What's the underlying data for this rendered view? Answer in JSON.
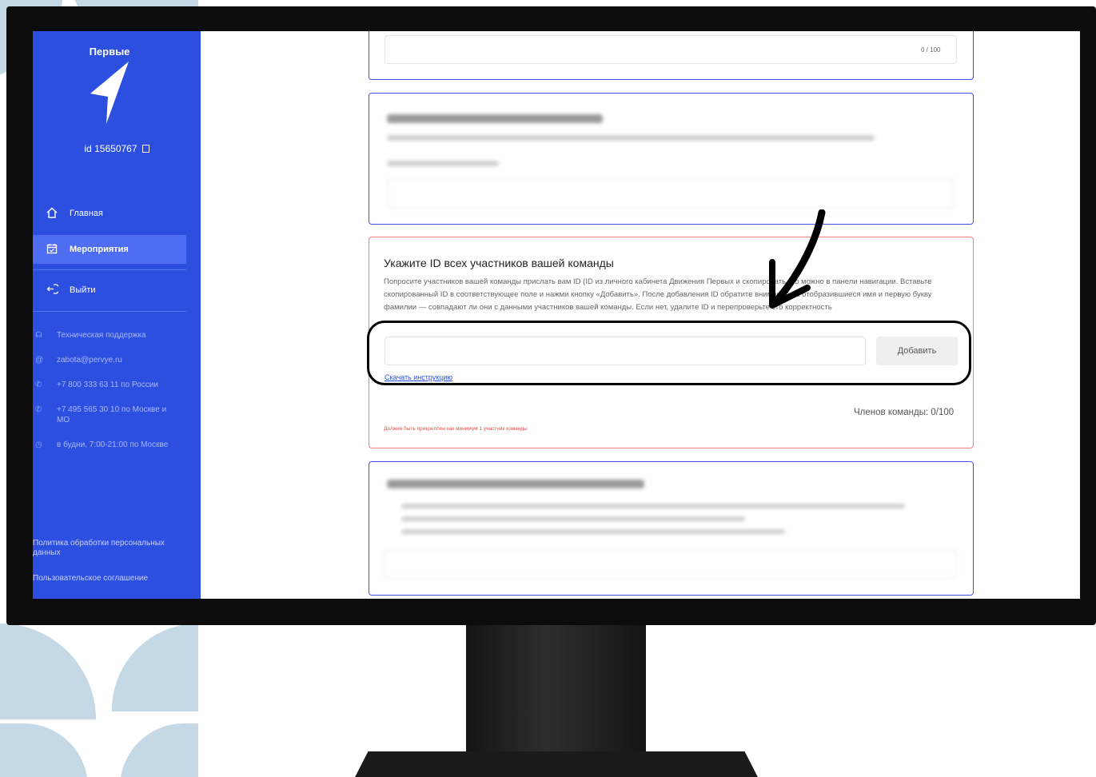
{
  "sidebar": {
    "logo_text": "Первые",
    "user_id": "id 15650767",
    "nav": [
      {
        "label": "Главная",
        "icon": "home-icon",
        "active": false
      },
      {
        "label": "Мероприятия",
        "icon": "calendar-icon",
        "active": true
      },
      {
        "label": "Выйти",
        "icon": "logout-icon",
        "active": false
      }
    ],
    "contacts": [
      {
        "icon": "headphones-icon",
        "text": "Техническая поддержка"
      },
      {
        "icon": "at-icon",
        "text": "zabota@pervye.ru"
      },
      {
        "icon": "phone-icon",
        "text": "+7 800 333 63 11 по России"
      },
      {
        "icon": "phone-icon",
        "text": "+7 495 565 30 10 по Москве и МО"
      },
      {
        "icon": "clock-icon",
        "text": "в будни, 7:00-21:00 по Москве"
      }
    ],
    "legal": {
      "privacy": "Политика обработки персональных данных",
      "agreement": "Пользовательское соглашение"
    }
  },
  "top_card": {
    "counter": "0 / 100"
  },
  "team_card": {
    "title": "Укажите ID всех участников вашей команды",
    "description": "Попросите участников вашей команды прислать вам ID (ID из личного кабинета Движения Первых и скопировать его можно в панели навигации. Вставьте скопированный ID в соответствующее поле и нажми кнопку «Добавить». После добавления ID обратите внимание на отобразившиеся имя и первую букву фамилии — совпадают ли они с данными участников вашей команды. Если нет, удалите ID и перепроверьте его корректность",
    "id_input_value": "",
    "add_button": "Добавить",
    "instruction_link": "Скачать инструкцию",
    "members_count": "Членов команды: 0/100",
    "error": "Должен быть прикреплен как минимум 1 участник команды"
  },
  "colors": {
    "sidebar": "#2d4fe0",
    "card_border": "#3b55e0",
    "error_border": "#e8827f"
  }
}
